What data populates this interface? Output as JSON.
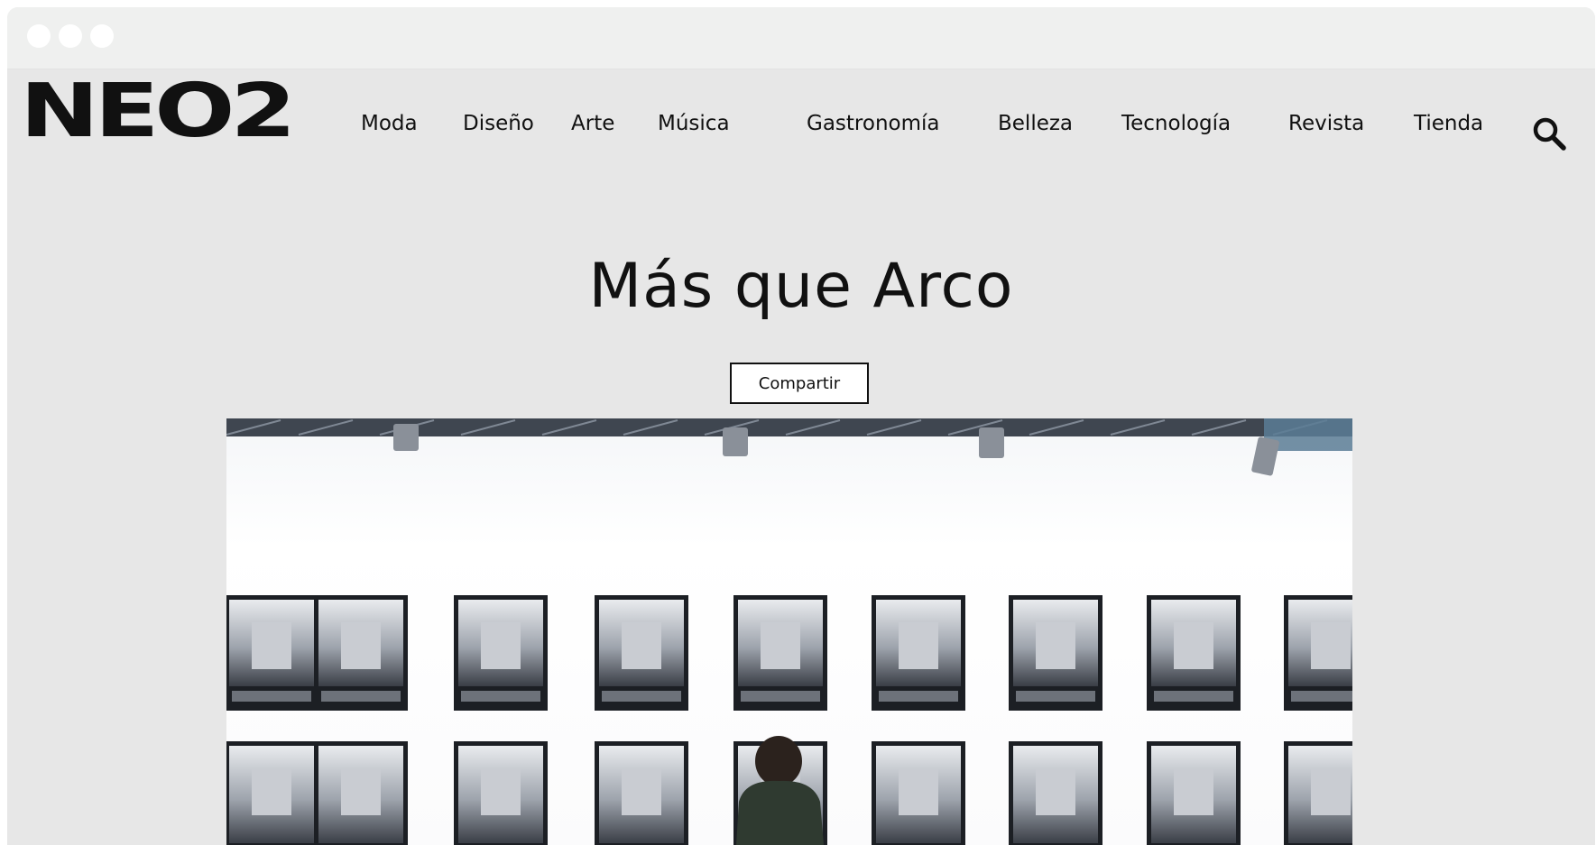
{
  "window": {
    "controls": [
      "close",
      "minimize",
      "maximize"
    ]
  },
  "header": {
    "logo_text": "NEO2",
    "nav": [
      {
        "label": "Moda"
      },
      {
        "label": "Diseño"
      },
      {
        "label": "Arte"
      },
      {
        "label": "Música"
      },
      {
        "label": "Gastronomía"
      },
      {
        "label": "Belleza"
      },
      {
        "label": "Tecnología"
      },
      {
        "label": "Revista"
      },
      {
        "label": "Tienda"
      }
    ],
    "search_icon": "search-icon"
  },
  "article": {
    "title": "Más que Arco",
    "share_label": "Compartir",
    "hero_image": "gallery wall of framed portrait photographs with blurred faces, visitor standing in front"
  },
  "colors": {
    "page_background": "#e7e7e7",
    "chrome_bar": "#eff0ef",
    "text": "#111111",
    "button_background": "#ffffff"
  }
}
